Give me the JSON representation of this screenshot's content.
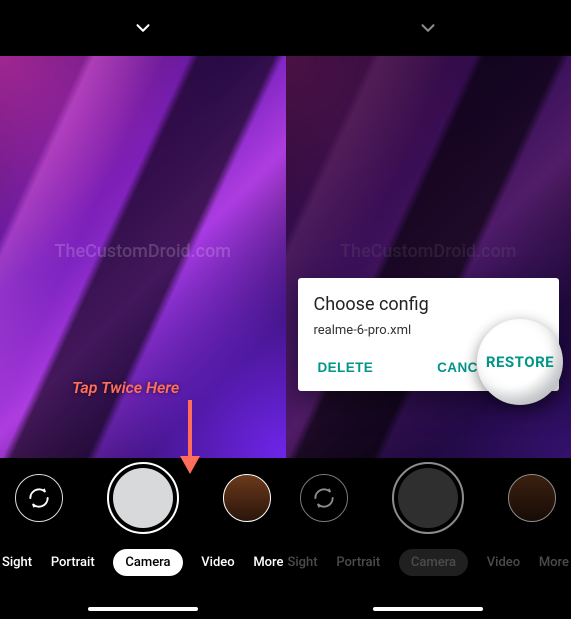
{
  "watermark": "TheCustomDroid.com",
  "left": {
    "modes": [
      "Sight",
      "Portrait",
      "Camera",
      "Video",
      "More"
    ],
    "selected_mode_index": 2,
    "annotation": "Tap Twice Here"
  },
  "right": {
    "modes": [
      "Sight",
      "Portrait",
      "Camera",
      "Video",
      "More"
    ],
    "selected_mode_index": 2,
    "dialog": {
      "title": "Choose config",
      "selected_file": "realme-6-pro.xml",
      "buttons": {
        "delete": "DELETE",
        "cancel": "CANCEL",
        "restore": "RESTORE"
      }
    }
  },
  "icons": {
    "chevron": "chevron-down-icon",
    "switch": "switch-camera-icon"
  }
}
